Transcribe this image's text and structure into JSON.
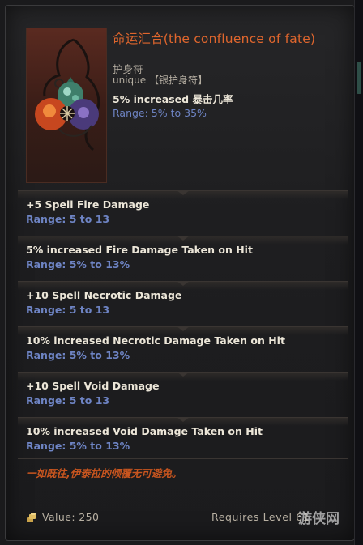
{
  "item": {
    "title": "命运汇合(the confluence of fate)",
    "type": "护身符",
    "rarity": "unique 【银护身符】",
    "implicit": "5% increased 暴击几率",
    "implicit_range": "Range: 5% to 35%"
  },
  "mods": [
    {
      "text": "+5 Spell Fire Damage",
      "range": "Range: 5 to 13"
    },
    {
      "text": "5% increased Fire Damage Taken on Hit",
      "range": "Range: 5% to 13%"
    },
    {
      "text": "+10 Spell Necrotic Damage",
      "range": "Range: 5 to 13"
    },
    {
      "text": "10% increased Necrotic Damage Taken on Hit",
      "range": "Range: 5% to 13%"
    },
    {
      "text": "+10 Spell Void Damage",
      "range": "Range: 5 to 13"
    },
    {
      "text": "10% increased Void Damage Taken on Hit",
      "range": "Range: 5% to 13%"
    }
  ],
  "lore": "一如既往,伊泰拉的倾覆无可避免。",
  "footer": {
    "value": "Value: 250",
    "requires": "Requires Level 61"
  },
  "watermark": "游侠网",
  "colors": {
    "title": "#e0662d",
    "range": "#6e84c4",
    "lore": "#c8551f",
    "panel": "#1e1e20"
  },
  "icons": {
    "item_image": "amulet-icon",
    "coin": "coin-icon"
  }
}
